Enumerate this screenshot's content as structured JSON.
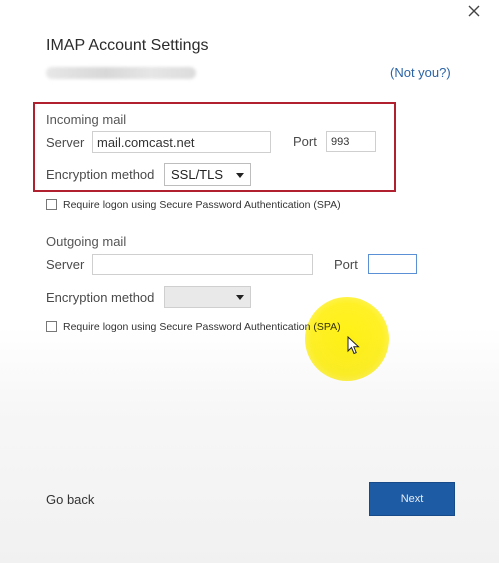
{
  "dialog": {
    "title": "IMAP Account Settings",
    "not_you_link": "(Not you?)"
  },
  "incoming": {
    "section_label": "Incoming mail",
    "server_label": "Server",
    "server_value": "mail.comcast.net",
    "port_label": "Port",
    "port_value": "993",
    "encryption_label": "Encryption method",
    "encryption_value": "SSL/TLS",
    "spa_label": "Require logon using Secure Password Authentication (SPA)",
    "spa_checked": false
  },
  "outgoing": {
    "section_label": "Outgoing mail",
    "server_label": "Server",
    "server_value": "",
    "port_label": "Port",
    "port_value": "",
    "encryption_label": "Encryption method",
    "encryption_value": "",
    "spa_label": "Require logon using Secure Password Authentication (SPA)",
    "spa_checked": false
  },
  "footer": {
    "go_back_label": "Go back",
    "next_label": "Next"
  },
  "colors": {
    "accent_blue": "#1e5ba5",
    "highlight_red": "#b0202e",
    "cursor_highlight": "#fff000"
  },
  "icons": {
    "close": "close-icon",
    "dropdown": "chevron-down-icon",
    "pointer": "mouse-pointer-icon"
  }
}
